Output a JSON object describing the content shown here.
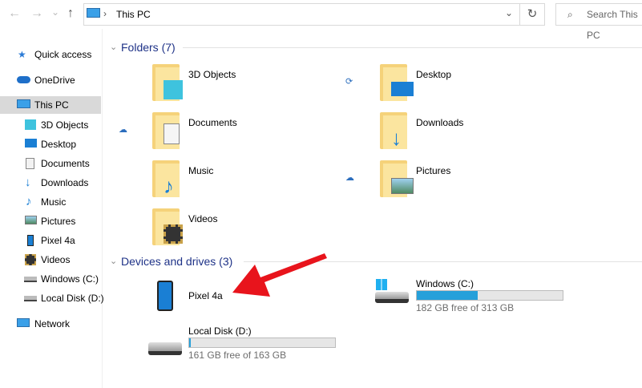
{
  "toolbar": {
    "back": "←",
    "forward": "→",
    "recent": "⌄",
    "up": "↑",
    "path_separator": "›",
    "path": "This PC",
    "dropdown": "⌄",
    "refresh": "↻",
    "search_placeholder": "Search This PC"
  },
  "sidebar": {
    "items": [
      {
        "label": "Quick access",
        "icon": "star-icon"
      },
      {
        "label": "OneDrive",
        "icon": "cloud-icon"
      },
      {
        "label": "This PC",
        "icon": "computer-icon",
        "selected": true
      },
      {
        "label": "3D Objects",
        "icon": "cube-icon"
      },
      {
        "label": "Desktop",
        "icon": "desktop-icon"
      },
      {
        "label": "Documents",
        "icon": "document-icon"
      },
      {
        "label": "Downloads",
        "icon": "download-icon"
      },
      {
        "label": "Music",
        "icon": "music-icon"
      },
      {
        "label": "Pictures",
        "icon": "pictures-icon"
      },
      {
        "label": "Pixel 4a",
        "icon": "phone-icon"
      },
      {
        "label": "Videos",
        "icon": "video-icon"
      },
      {
        "label": "Windows (C:)",
        "icon": "drive-icon"
      },
      {
        "label": "Local Disk (D:)",
        "icon": "drive-icon"
      },
      {
        "label": "Network",
        "icon": "network-icon"
      }
    ]
  },
  "main": {
    "folders_header": "Folders (7)",
    "folders": [
      "3D Objects",
      "Desktop",
      "Documents",
      "Downloads",
      "Music",
      "Pictures",
      "Videos"
    ],
    "devices_header": "Devices and drives (3)",
    "devices": [
      {
        "label": "Pixel 4a"
      },
      {
        "label": "Windows (C:)",
        "free": "182 GB free of 313 GB",
        "used_fraction": 0.42
      },
      {
        "label": "Local Disk (D:)",
        "free": "161 GB free of 163 GB",
        "used_fraction": 0.012
      }
    ]
  },
  "colors": {
    "accent": "#26a0da",
    "header": "#1e3287",
    "arrow": "#e8141c"
  }
}
